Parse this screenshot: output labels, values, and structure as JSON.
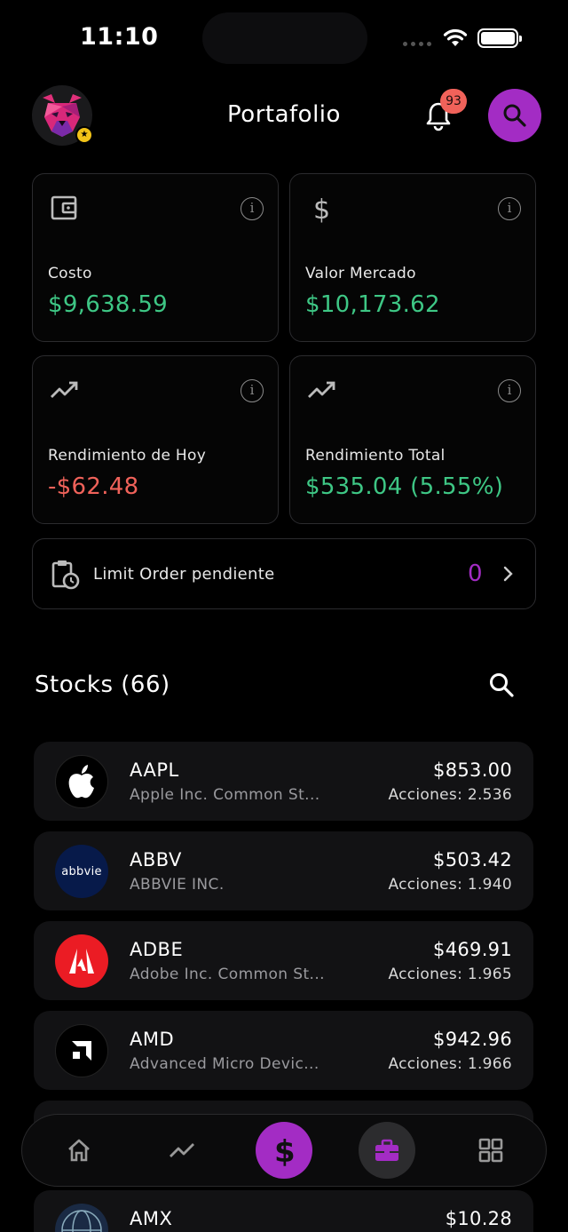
{
  "status_bar": {
    "time": "11:10"
  },
  "header": {
    "title": "Portafolio",
    "notification_count": "93"
  },
  "cards": [
    {
      "label": "Costo",
      "value": "$9,638.59",
      "icon": "wallet-icon",
      "color": "#3ec785"
    },
    {
      "label": "Valor Mercado",
      "value": "$10,173.62",
      "icon": "dollar-icon",
      "color": "#3ec785"
    },
    {
      "label": "Rendimiento de Hoy",
      "value": "-$62.48",
      "icon": "trending-up-icon",
      "color": "#f0625a"
    },
    {
      "label": "Rendimiento Total",
      "value": "$535.04 (5.55%)",
      "icon": "trending-up-icon",
      "color": "#3ec785"
    }
  ],
  "limit_orders": {
    "label": "Limit Order pendiente",
    "count": "0"
  },
  "stocks_section": {
    "title": "Stocks (66)"
  },
  "stocks": [
    {
      "ticker": "AAPL",
      "name": "Apple Inc. Common St...",
      "price": "$853.00",
      "shares": "Acciones: 2.536",
      "logo": "apple-logo"
    },
    {
      "ticker": "ABBV",
      "name": "ABBVIE INC.",
      "price": "$503.42",
      "shares": "Acciones: 1.940",
      "logo": "abbvie-logo",
      "logo_text": "abbvie"
    },
    {
      "ticker": "ADBE",
      "name": "Adobe Inc. Common St...",
      "price": "$469.91",
      "shares": "Acciones: 1.965",
      "logo": "adobe-logo"
    },
    {
      "ticker": "AMD",
      "name": "Advanced Micro Devic...",
      "price": "$942.96",
      "shares": "Acciones: 1.966",
      "logo": "amd-logo"
    },
    {
      "ticker": "AMX",
      "name": "",
      "price": "$10.28",
      "shares": "",
      "logo": "amx-logo"
    }
  ],
  "nav": [
    {
      "name": "home",
      "icon": "home-icon"
    },
    {
      "name": "markets",
      "icon": "trending-icon"
    },
    {
      "name": "trade",
      "icon": "dollar-icon",
      "active": true
    },
    {
      "name": "portfolio",
      "icon": "briefcase-icon",
      "selected": true
    },
    {
      "name": "more",
      "icon": "grid-icon"
    }
  ],
  "colors": {
    "accent": "#a32cc4",
    "positive": "#3ec785",
    "negative": "#f0625a",
    "badge": "#f0625a"
  }
}
